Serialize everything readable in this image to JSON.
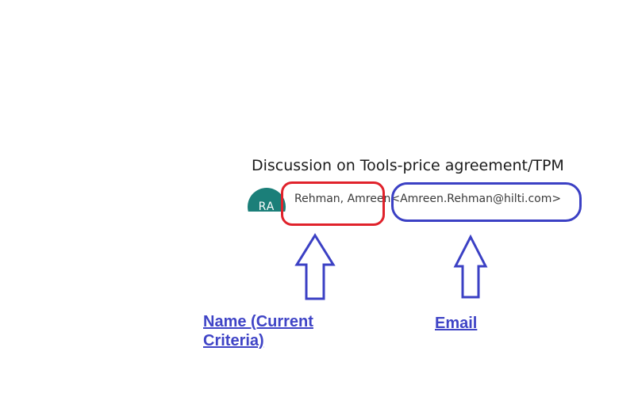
{
  "email": {
    "subject": "Discussion on Tools-price agreement/TPM",
    "avatar_initials": "RA",
    "sender_name": "Rehman, Amreen",
    "sender_email": "<Amreen.Rehman@hilti.com>"
  },
  "annotations": {
    "name_label": "Name (Current Criteria)",
    "email_label": "Email"
  },
  "colors": {
    "avatar_bg": "#1b7f79",
    "name_highlight": "#e0222b",
    "email_highlight": "#3b40c4",
    "annotation_text": "#3f44c6"
  }
}
